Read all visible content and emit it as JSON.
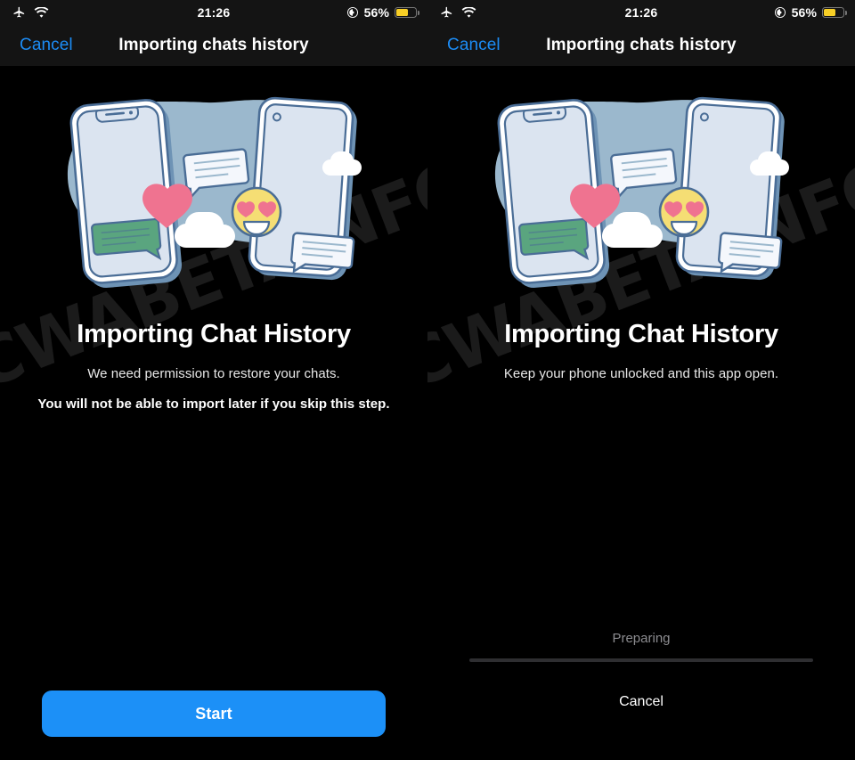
{
  "panels": [
    {
      "id": "permission-step",
      "status_bar": {
        "airplane_icon": "airplane-icon",
        "wifi_icon": "wifi-icon",
        "time": "21:26",
        "location_icon": "location-icon",
        "battery_percent": "56%",
        "battery_level": 56,
        "battery_color": "#f8cf26"
      },
      "nav": {
        "cancel_label": "Cancel",
        "title": "Importing chats history"
      },
      "heading": "Importing Chat History",
      "subtitle": "We need permission to restore your chats.",
      "warning": "You will not be able to import later if you skip this step.",
      "primary_button": "Start",
      "watermark": "CWABETAINFO"
    },
    {
      "id": "progress-step",
      "status_bar": {
        "airplane_icon": "airplane-icon",
        "wifi_icon": "wifi-icon",
        "time": "21:26",
        "location_icon": "location-icon",
        "battery_percent": "56%",
        "battery_level": 56,
        "battery_color": "#f8cf26"
      },
      "nav": {
        "cancel_label": "Cancel",
        "title": "Importing chats history"
      },
      "heading": "Importing Chat History",
      "subtitle": "Keep your phone unlocked and this app open.",
      "progress": {
        "status_label": "Preparing",
        "percent": 0,
        "cancel_label": "Cancel"
      },
      "watermark": "CWABETAINFO"
    }
  ],
  "illustration": {
    "name": "chat-transfer-illustration",
    "colors": {
      "blob": "#9bb8cd",
      "phone_screen": "#dbe4f0",
      "phone_outline": "#4a6d96",
      "phone_shadow": "#6e93b5",
      "heart": "#ef7390",
      "emoji": "#f5de74",
      "emoji_outline": "#4a6d96",
      "green_bubble": "#5aa57f",
      "cloud": "#ffffff",
      "bubble_line": "#9bb8cd"
    }
  },
  "theme": {
    "background": "#000000",
    "bar_background": "#141414",
    "accent": "#1c90f7",
    "link": "#1c8cf5",
    "muted_text": "#8c8c90",
    "watermark": "#1b1b1b"
  }
}
